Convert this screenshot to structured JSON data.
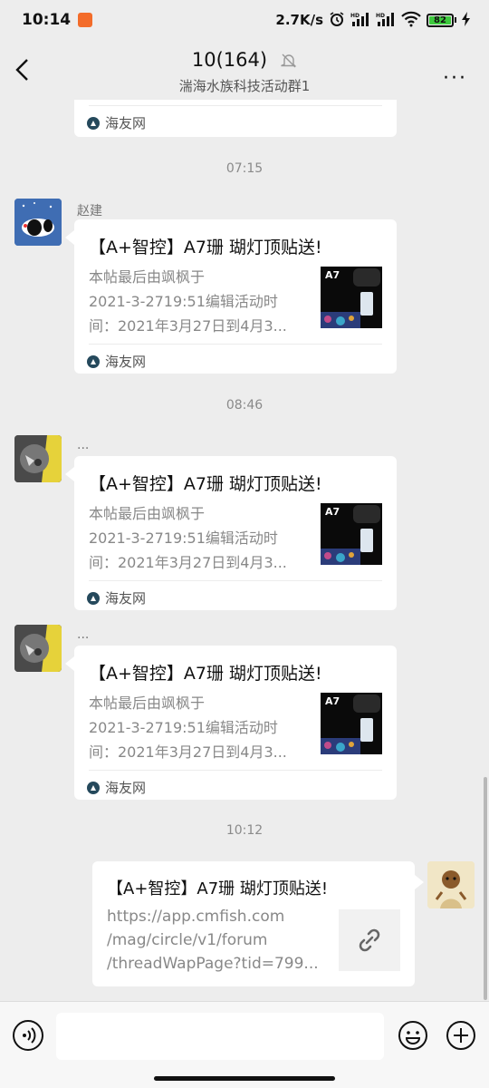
{
  "status_bar": {
    "time": "10:14",
    "net_speed": "2.7K/s",
    "battery": "82",
    "hd1": "HD",
    "hd2": "HD"
  },
  "header": {
    "title": "10(164)",
    "subtitle": "湍海水族科技活动群1",
    "more": "···"
  },
  "messages": {
    "partial": {
      "source": "海友网"
    },
    "ts1": "07:15",
    "msg1": {
      "sender": "赵建",
      "title": "【A+智控】A7珊 瑚灯顶贴送!",
      "desc1": "本帖最后由飒枫于",
      "desc2": "2021-3-2719:51编辑活动时",
      "desc3": "间：2021年3月27日到4月3...",
      "thumb_text": "A7",
      "source": "海友网"
    },
    "ts2": "08:46",
    "msg2": {
      "sender": "...",
      "title": "【A+智控】A7珊 瑚灯顶贴送!",
      "desc1": "本帖最后由飒枫于",
      "desc2": "2021-3-2719:51编辑活动时",
      "desc3": "间：2021年3月27日到4月3...",
      "thumb_text": "A7",
      "source": "海友网"
    },
    "msg3": {
      "sender": "...",
      "title": "【A+智控】A7珊 瑚灯顶贴送!",
      "desc1": "本帖最后由飒枫于",
      "desc2": "2021-3-2719:51编辑活动时",
      "desc3": "间：2021年3月27日到4月3...",
      "thumb_text": "A7",
      "source": "海友网"
    },
    "ts3": "10:12",
    "msg4": {
      "title": "【A+智控】A7珊 瑚灯顶贴送!",
      "url1": "https://app.cmfish.com",
      "url2": "/mag/circle/v1/forum",
      "url3": "/threadWapPage?tid=799..."
    }
  },
  "input_bar": {
    "placeholder": ""
  }
}
